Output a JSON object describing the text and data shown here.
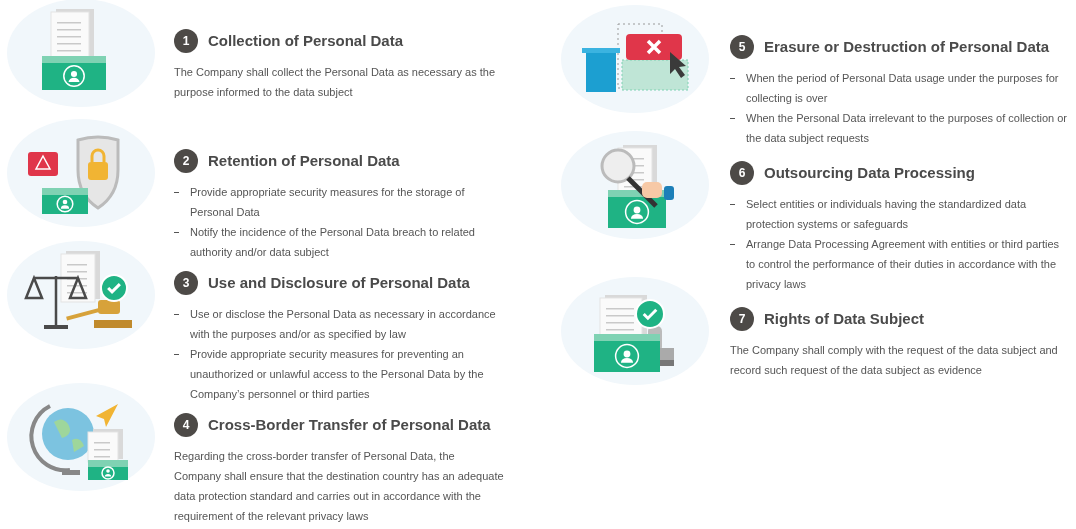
{
  "columns": [
    {
      "sections": [
        {
          "number": "1",
          "title": "Collection of Personal Data",
          "kind": "paragraph",
          "text": "The Company shall collect the Personal Data as necessary as the purpose informed to the data subject"
        },
        {
          "number": "2",
          "title": "Retention of Personal Data",
          "kind": "bullets",
          "items": [
            "Provide appropriate security measures for the storage of Personal Data",
            "Notify the incidence of the Personal Data breach to related authority and/or data subject"
          ]
        },
        {
          "number": "3",
          "title": "Use and Disclosure of Personal Data",
          "kind": "bullets",
          "items": [
            "Use or disclose the Personal Data as necessary in accordance with the purposes and/or as specified by law",
            "Provide appropriate security measures for preventing an unauthorized or unlawful access to the Personal Data by the Company’s personnel or third parties"
          ]
        },
        {
          "number": "4",
          "title": "Cross-Border Transfer of Personal Data",
          "kind": "paragraph",
          "text": "Regarding the cross-border transfer of Personal Data, the Company shall ensure that the destination country has an adequate data protection standard and carries out in accordance with the requirement of the relevant privacy laws"
        }
      ]
    },
    {
      "sections": [
        {
          "number": "5",
          "title": "Erasure or Destruction of Personal Data",
          "kind": "bullets",
          "items": [
            "When the period of Personal Data usage under the purposes for collecting is over",
            "When the Personal Data irrelevant to the purposes of collection or the data subject requests"
          ]
        },
        {
          "number": "6",
          "title": "Outsourcing Data Processing",
          "kind": "bullets",
          "items": [
            "Select entities or individuals having the standardized data protection systems or safeguards",
            "Arrange Data Processing Agreement with entities or third parties to control the performance of their duties in accordance with the privacy laws"
          ]
        },
        {
          "number": "7",
          "title": "Rights of Data Subject",
          "kind": "paragraph",
          "text": "The Company shall comply with the request of the data subject and record such request of the data subject as evidence"
        }
      ]
    }
  ]
}
